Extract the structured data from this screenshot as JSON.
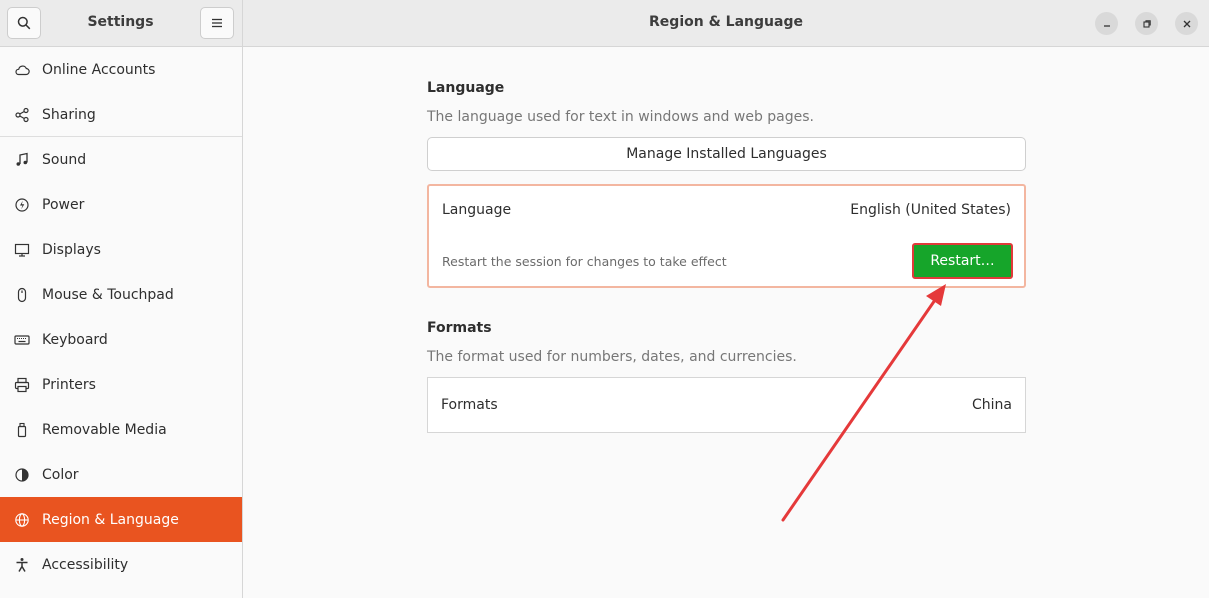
{
  "sidebar": {
    "title": "Settings",
    "items": [
      {
        "label": "Online Accounts",
        "icon": "cloud-icon"
      },
      {
        "label": "Sharing",
        "icon": "share-icon"
      },
      {
        "label": "Sound",
        "icon": "music-note-icon"
      },
      {
        "label": "Power",
        "icon": "power-icon"
      },
      {
        "label": "Displays",
        "icon": "display-icon"
      },
      {
        "label": "Mouse & Touchpad",
        "icon": "mouse-icon"
      },
      {
        "label": "Keyboard",
        "icon": "keyboard-icon"
      },
      {
        "label": "Printers",
        "icon": "printer-icon"
      },
      {
        "label": "Removable Media",
        "icon": "usb-drive-icon"
      },
      {
        "label": "Color",
        "icon": "color-icon"
      },
      {
        "label": "Region & Language",
        "icon": "globe-icon",
        "active": true
      },
      {
        "label": "Accessibility",
        "icon": "accessibility-icon"
      }
    ]
  },
  "header": {
    "title": "Region & Language"
  },
  "language_section": {
    "title": "Language",
    "description": "The language used for text in windows and web pages.",
    "manage_button": "Manage Installed Languages",
    "row_label": "Language",
    "row_value": "English (United States)",
    "restart_note": "Restart the session for changes to take effect",
    "restart_button": "Restart…"
  },
  "formats_section": {
    "title": "Formats",
    "description": "The format used for numbers, dates, and currencies.",
    "row_label": "Formats",
    "row_value": "China"
  },
  "colors": {
    "accent": "#e95420",
    "restart_button": "#16a52a",
    "highlight": "#e03a3a"
  }
}
